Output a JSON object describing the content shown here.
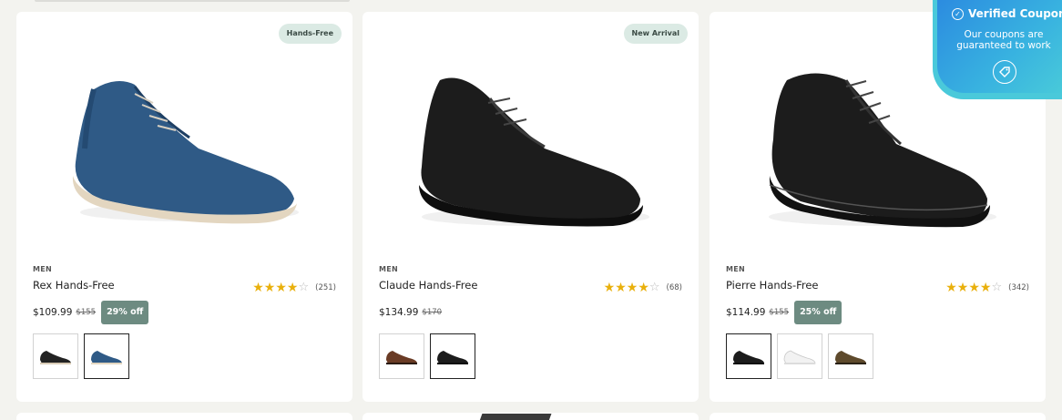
{
  "coupon": {
    "title": "Verified Coupon",
    "subtitle": "Our coupons are guaranteed to work",
    "check_icon": "check-circle-icon",
    "coupon_icon": "coupon-tag-icon"
  },
  "products": [
    {
      "badge": "Hands-Free",
      "category": "MEN",
      "name": "Rex Hands-Free",
      "rating": 4,
      "rating_count": "(251)",
      "price": "$109.99",
      "original_price": "$155",
      "discount": "29% off",
      "image_icon": "blue-knit-sneaker-image",
      "swatches": [
        {
          "color": "black",
          "selected": false
        },
        {
          "color": "navy",
          "selected": true
        }
      ]
    },
    {
      "badge": "New Arrival",
      "category": "MEN",
      "name": "Claude Hands-Free",
      "rating": 4,
      "rating_count": "(68)",
      "price": "$134.99",
      "original_price": "$170",
      "discount": "",
      "image_icon": "black-leather-derby-image",
      "swatches": [
        {
          "color": "brown",
          "selected": false
        },
        {
          "color": "black",
          "selected": true
        }
      ]
    },
    {
      "badge": "",
      "category": "MEN",
      "name": "Pierre Hands-Free",
      "rating": 4,
      "rating_count": "(342)",
      "price": "$114.99",
      "original_price": "$155",
      "discount": "25% off",
      "image_icon": "black-leather-sneaker-image",
      "swatches": [
        {
          "color": "black",
          "selected": true
        },
        {
          "color": "white",
          "selected": false
        },
        {
          "color": "olive-brown",
          "selected": false
        }
      ]
    }
  ],
  "colors": {
    "star": "#e9b00c",
    "discount_bg": "#6d8b81",
    "badge_bg": "#dbeae4",
    "coupon_gradient_start": "#2b8ae0",
    "coupon_gradient_end": "#4ccfd8"
  }
}
